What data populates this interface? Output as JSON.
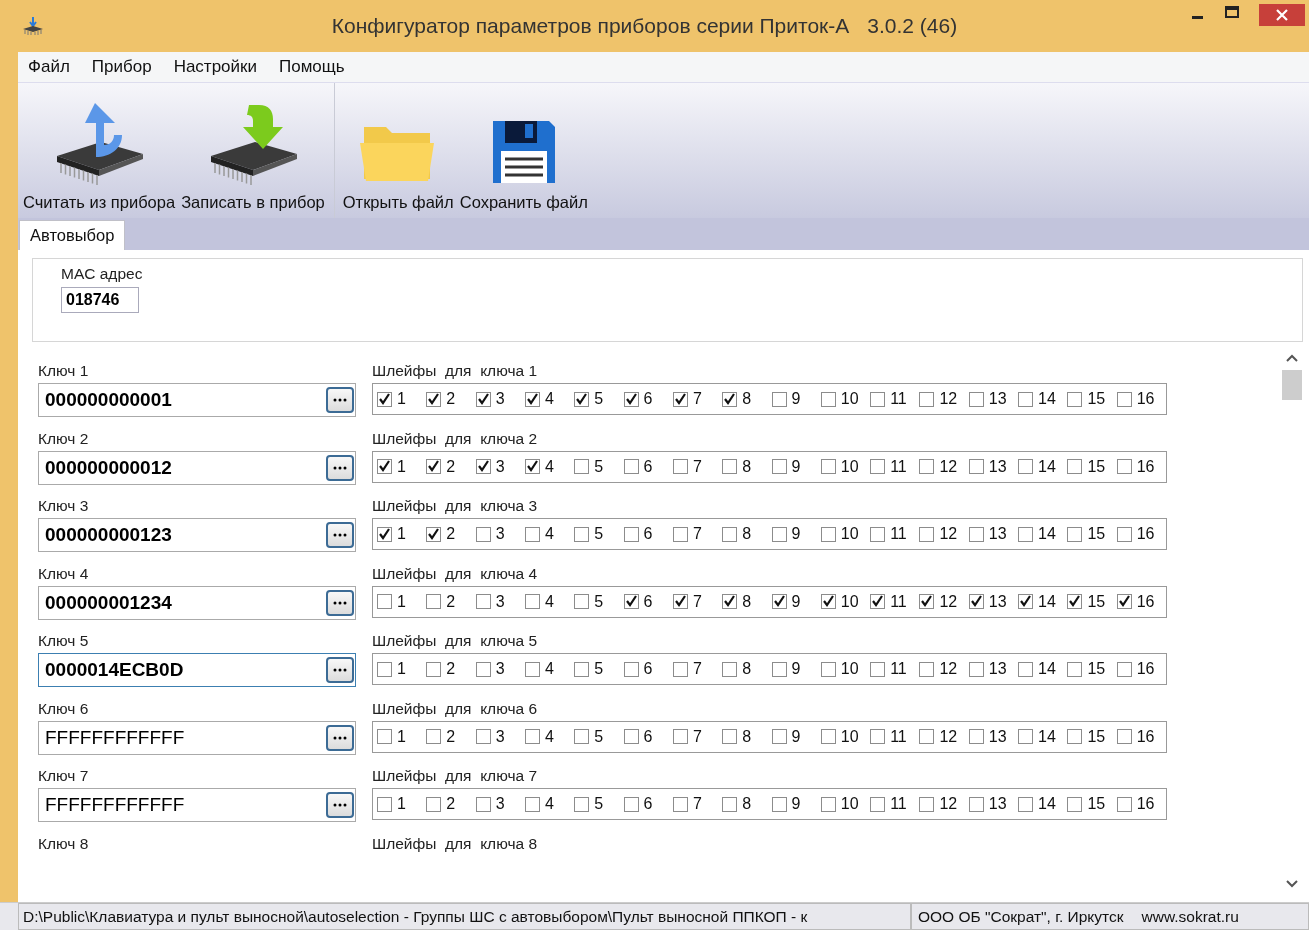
{
  "window": {
    "title": "Конфигуратор параметров приборов серии Приток-А",
    "version": "3.0.2 (46)"
  },
  "menu": [
    {
      "label": "Файл"
    },
    {
      "label": "Прибор"
    },
    {
      "label": "Настройки"
    },
    {
      "label": "Помощь"
    }
  ],
  "toolbar": [
    {
      "label": "Считать из прибора",
      "kind": "chip-up",
      "separator_before": false
    },
    {
      "label": "Записать в прибор",
      "kind": "chip-down",
      "separator_before": false
    },
    {
      "label": "Открыть файл",
      "kind": "folder",
      "separator_before": true
    },
    {
      "label": "Сохранить файл",
      "kind": "floppy",
      "separator_before": false
    }
  ],
  "tabs": [
    {
      "label": "Автовыбор",
      "selected": true
    }
  ],
  "mac": {
    "label": "MAC адрес",
    "value": "018746"
  },
  "keys": [
    {
      "label": "Ключ 1",
      "value": "000000000001",
      "bold": true,
      "focused": false,
      "loops_label": "Шлейфы  для  ключа 1",
      "loops": [
        {
          "label": "1",
          "checked": true
        },
        {
          "label": "2",
          "checked": true
        },
        {
          "label": "3",
          "checked": true
        },
        {
          "label": "4",
          "checked": true
        },
        {
          "label": "5",
          "checked": true
        },
        {
          "label": "6",
          "checked": true
        },
        {
          "label": "7",
          "checked": true
        },
        {
          "label": "8",
          "checked": true
        },
        {
          "label": "9",
          "checked": false
        },
        {
          "label": "10",
          "checked": false
        },
        {
          "label": "11",
          "checked": false
        },
        {
          "label": "12",
          "checked": false
        },
        {
          "label": "13",
          "checked": false
        },
        {
          "label": "14",
          "checked": false
        },
        {
          "label": "15",
          "checked": false
        },
        {
          "label": "16",
          "checked": false
        }
      ]
    },
    {
      "label": "Ключ 2",
      "value": "000000000012",
      "bold": true,
      "focused": false,
      "loops_label": "Шлейфы  для  ключа 2",
      "loops": [
        {
          "label": "1",
          "checked": true
        },
        {
          "label": "2",
          "checked": true
        },
        {
          "label": "3",
          "checked": true
        },
        {
          "label": "4",
          "checked": true
        },
        {
          "label": "5",
          "checked": false
        },
        {
          "label": "6",
          "checked": false
        },
        {
          "label": "7",
          "checked": false
        },
        {
          "label": "8",
          "checked": false
        },
        {
          "label": "9",
          "checked": false
        },
        {
          "label": "10",
          "checked": false
        },
        {
          "label": "11",
          "checked": false
        },
        {
          "label": "12",
          "checked": false
        },
        {
          "label": "13",
          "checked": false
        },
        {
          "label": "14",
          "checked": false
        },
        {
          "label": "15",
          "checked": false
        },
        {
          "label": "16",
          "checked": false
        }
      ]
    },
    {
      "label": "Ключ 3",
      "value": "000000000123",
      "bold": true,
      "focused": false,
      "loops_label": "Шлейфы  для  ключа 3",
      "loops": [
        {
          "label": "1",
          "checked": true
        },
        {
          "label": "2",
          "checked": true
        },
        {
          "label": "3",
          "checked": false
        },
        {
          "label": "4",
          "checked": false
        },
        {
          "label": "5",
          "checked": false
        },
        {
          "label": "6",
          "checked": false
        },
        {
          "label": "7",
          "checked": false
        },
        {
          "label": "8",
          "checked": false
        },
        {
          "label": "9",
          "checked": false
        },
        {
          "label": "10",
          "checked": false
        },
        {
          "label": "11",
          "checked": false
        },
        {
          "label": "12",
          "checked": false
        },
        {
          "label": "13",
          "checked": false
        },
        {
          "label": "14",
          "checked": false
        },
        {
          "label": "15",
          "checked": false
        },
        {
          "label": "16",
          "checked": false
        }
      ]
    },
    {
      "label": "Ключ 4",
      "value": "000000001234",
      "bold": true,
      "focused": false,
      "loops_label": "Шлейфы  для  ключа 4",
      "loops": [
        {
          "label": "1",
          "checked": false
        },
        {
          "label": "2",
          "checked": false
        },
        {
          "label": "3",
          "checked": false
        },
        {
          "label": "4",
          "checked": false
        },
        {
          "label": "5",
          "checked": false
        },
        {
          "label": "6",
          "checked": true
        },
        {
          "label": "7",
          "checked": true
        },
        {
          "label": "8",
          "checked": true
        },
        {
          "label": "9",
          "checked": true
        },
        {
          "label": "10",
          "checked": true
        },
        {
          "label": "11",
          "checked": true
        },
        {
          "label": "12",
          "checked": true
        },
        {
          "label": "13",
          "checked": true
        },
        {
          "label": "14",
          "checked": true
        },
        {
          "label": "15",
          "checked": true
        },
        {
          "label": "16",
          "checked": true
        }
      ]
    },
    {
      "label": "Ключ 5",
      "value": "0000014ECB0D",
      "bold": true,
      "focused": true,
      "loops_label": "Шлейфы  для  ключа 5",
      "loops": [
        {
          "label": "1",
          "checked": false
        },
        {
          "label": "2",
          "checked": false
        },
        {
          "label": "3",
          "checked": false
        },
        {
          "label": "4",
          "checked": false
        },
        {
          "label": "5",
          "checked": false
        },
        {
          "label": "6",
          "checked": false
        },
        {
          "label": "7",
          "checked": false
        },
        {
          "label": "8",
          "checked": false
        },
        {
          "label": "9",
          "checked": false
        },
        {
          "label": "10",
          "checked": false
        },
        {
          "label": "11",
          "checked": false
        },
        {
          "label": "12",
          "checked": false
        },
        {
          "label": "13",
          "checked": false
        },
        {
          "label": "14",
          "checked": false
        },
        {
          "label": "15",
          "checked": false
        },
        {
          "label": "16",
          "checked": false
        }
      ]
    },
    {
      "label": "Ключ 6",
      "value": "FFFFFFFFFFFF",
      "bold": false,
      "focused": false,
      "loops_label": "Шлейфы  для  ключа 6",
      "loops": [
        {
          "label": "1",
          "checked": false
        },
        {
          "label": "2",
          "checked": false
        },
        {
          "label": "3",
          "checked": false
        },
        {
          "label": "4",
          "checked": false
        },
        {
          "label": "5",
          "checked": false
        },
        {
          "label": "6",
          "checked": false
        },
        {
          "label": "7",
          "checked": false
        },
        {
          "label": "8",
          "checked": false
        },
        {
          "label": "9",
          "checked": false
        },
        {
          "label": "10",
          "checked": false
        },
        {
          "label": "11",
          "checked": false
        },
        {
          "label": "12",
          "checked": false
        },
        {
          "label": "13",
          "checked": false
        },
        {
          "label": "14",
          "checked": false
        },
        {
          "label": "15",
          "checked": false
        },
        {
          "label": "16",
          "checked": false
        }
      ]
    },
    {
      "label": "Ключ 7",
      "value": "FFFFFFFFFFFF",
      "bold": false,
      "focused": false,
      "loops_label": "Шлейфы  для  ключа 7",
      "loops": [
        {
          "label": "1",
          "checked": false
        },
        {
          "label": "2",
          "checked": false
        },
        {
          "label": "3",
          "checked": false
        },
        {
          "label": "4",
          "checked": false
        },
        {
          "label": "5",
          "checked": false
        },
        {
          "label": "6",
          "checked": false
        },
        {
          "label": "7",
          "checked": false
        },
        {
          "label": "8",
          "checked": false
        },
        {
          "label": "9",
          "checked": false
        },
        {
          "label": "10",
          "checked": false
        },
        {
          "label": "11",
          "checked": false
        },
        {
          "label": "12",
          "checked": false
        },
        {
          "label": "13",
          "checked": false
        },
        {
          "label": "14",
          "checked": false
        },
        {
          "label": "15",
          "checked": false
        },
        {
          "label": "16",
          "checked": false
        }
      ]
    },
    {
      "label": "Ключ 8",
      "loops_label": "Шлейфы  для  ключа 8"
    }
  ],
  "status_bar": {
    "path": "D:\\Public\\Клавиатура и пульт выносной\\autoselection - Группы ШС с автовыбором\\Пульт выносной ППКОП - к",
    "company": "ООО ОБ \"Сократ\", г. Иркутск",
    "website": "www.sokrat.ru"
  }
}
